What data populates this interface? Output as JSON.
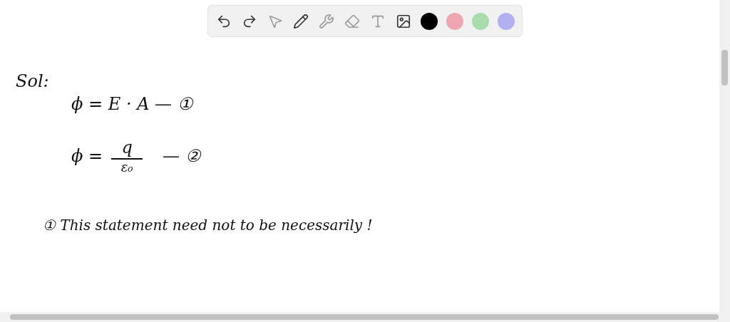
{
  "toolbar": {
    "tools": [
      {
        "kind": "undo"
      },
      {
        "kind": "redo"
      },
      {
        "kind": "pointer"
      },
      {
        "kind": "pen"
      },
      {
        "kind": "tools"
      },
      {
        "kind": "eraser"
      },
      {
        "kind": "text"
      },
      {
        "kind": "image"
      }
    ],
    "colors": [
      {
        "color": "#000000"
      },
      {
        "color": "#f0a6b0"
      },
      {
        "color": "#a9dcad"
      },
      {
        "color": "#b3b0ef"
      }
    ]
  },
  "canvas": {
    "lines": [
      {
        "kind": "plain",
        "text": "Sol:"
      },
      {
        "kind": "plain",
        "text": "ϕ = E · A  — ①"
      },
      {
        "kind": "fraction",
        "lead": "ϕ =",
        "numerator": "q",
        "denominator": "ε₀",
        "tail": "— ②"
      },
      {
        "kind": "plain",
        "text": "①  This  statement  need  not  to  be  necessarily  !"
      }
    ]
  }
}
